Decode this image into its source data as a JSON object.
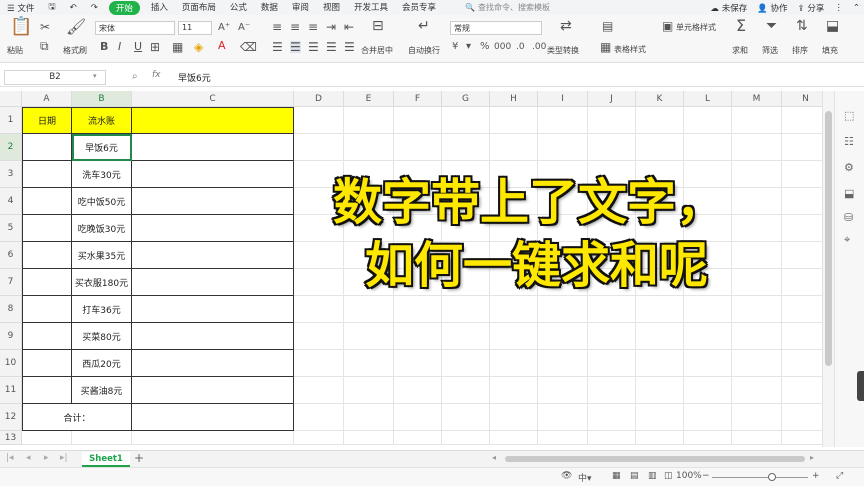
{
  "menubar": {
    "file": "文件",
    "items": [
      "开始",
      "插入",
      "页面布局",
      "公式",
      "数据",
      "审阅",
      "视图",
      "开发工具",
      "会员专享"
    ],
    "active_index": 0,
    "search_text": "查找命令、搜索模板",
    "unsaved": "未保存",
    "collab": "协作",
    "share": "分享"
  },
  "toolbar": {
    "paste": "粘贴",
    "format_painter": "格式刷",
    "font_name": "宋体",
    "font_size": "11",
    "merge_center": "合并居中",
    "auto_wrap": "自动换行",
    "number_format": "常规",
    "type_convert": "类型转换",
    "cell_style": "单元格样式",
    "table_style": "表格样式",
    "sum": "求和",
    "filter": "筛选",
    "sort": "排序",
    "fill": "填充"
  },
  "formula_bar": {
    "name_box": "B2",
    "fx": "fx",
    "content": "早饭6元"
  },
  "grid": {
    "columns": [
      "A",
      "B",
      "C",
      "D",
      "E",
      "F",
      "G",
      "H",
      "I",
      "J",
      "K",
      "L",
      "M",
      "N"
    ],
    "rows": [
      "1",
      "2",
      "3",
      "4",
      "5",
      "6",
      "7",
      "8",
      "9",
      "10",
      "11",
      "12",
      "13"
    ],
    "A1": "日期",
    "B1": "流水账",
    "B_values": [
      "早饭6元",
      "洗车30元",
      "吃中饭50元",
      "吃晚饭30元",
      "买水果35元",
      "买衣服180元",
      "打车36元",
      "买菜80元",
      "西瓜20元",
      "买酱油8元"
    ],
    "A12": "合计："
  },
  "overlay": {
    "line1": "数字带上了文字，",
    "line2": "如何一键求和呢"
  },
  "sheet": {
    "tab_name": "Sheet1",
    "add": "+"
  },
  "status": {
    "zoom": "100%",
    "ime": "中"
  },
  "colors": {
    "accent": "#1fb34a",
    "header_fill": "#ffff00",
    "overlay_text": "#ffe800"
  }
}
